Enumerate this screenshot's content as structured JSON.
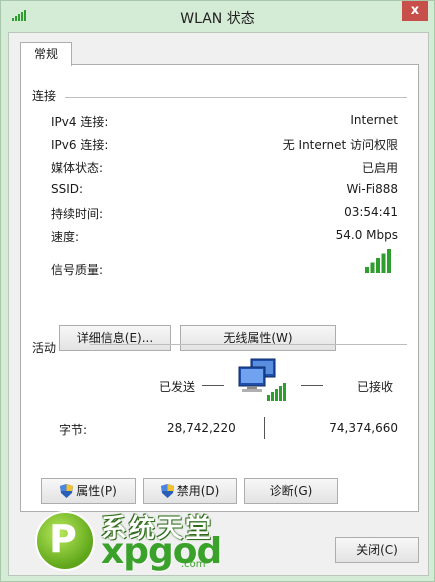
{
  "window": {
    "title": "WLAN 状态",
    "close_glyph": "x"
  },
  "tabs": [
    {
      "label": "常规"
    }
  ],
  "connection": {
    "group_label": "连接",
    "rows": [
      {
        "label": "IPv4 连接:",
        "value": "Internet"
      },
      {
        "label": "IPv6 连接:",
        "value": "无 Internet 访问权限"
      },
      {
        "label": "媒体状态:",
        "value": "已启用"
      },
      {
        "label": "SSID:",
        "value": "Wi-Fi888"
      },
      {
        "label": "持续时间:",
        "value": "03:54:41"
      },
      {
        "label": "速度:",
        "value": "54.0 Mbps"
      },
      {
        "label": "信号质量:",
        "value": "",
        "signal_bars_lit": 5,
        "signal_bars_total": 5
      }
    ],
    "details_button": "详细信息(E)...",
    "wireless_props_button": "无线属性(W)"
  },
  "activity": {
    "group_label": "活动",
    "sent_label": "已发送",
    "received_label": "已接收",
    "bytes_label": "字节:",
    "bytes_sent": "28,742,220",
    "bytes_received": "74,374,660"
  },
  "bottom_buttons": {
    "properties": "属性(P)",
    "disable": "禁用(D)",
    "diagnose": "诊断(G)"
  },
  "footer": {
    "close_button": "关闭(C)"
  },
  "watermark": {
    "brand_cn": "系统天堂",
    "brand_en": "xpgod",
    "brand_com": ".com",
    "logo_letter": "P"
  },
  "colors": {
    "signal": "#2e9e2e",
    "title_bar": "#d4ecd6",
    "close_button": "#c7504a",
    "watermark_green": "#3aa12a"
  },
  "icons": {
    "title": "wifi-signal-icon",
    "close": "close-icon",
    "network": "network-computers-icon",
    "shield": "uac-shield-icon",
    "signal": "signal-strength-icon"
  }
}
